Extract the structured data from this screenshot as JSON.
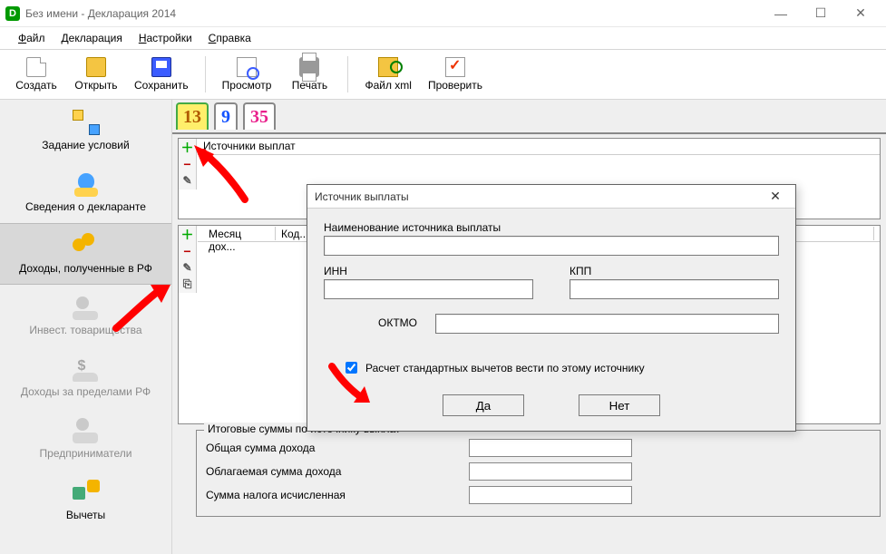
{
  "titlebar": {
    "title": "Без имени - Декларация 2014"
  },
  "menu": {
    "file": "Файл",
    "decl": "Декларация",
    "settings": "Настройки",
    "help": "Справка"
  },
  "toolbar": {
    "new": "Создать",
    "open": "Открыть",
    "save": "Сохранить",
    "preview": "Просмотр",
    "print": "Печать",
    "xml": "Файл xml",
    "check": "Проверить"
  },
  "sidebar": {
    "items": [
      {
        "label": "Задание условий"
      },
      {
        "label": "Сведения о декларанте"
      },
      {
        "label": "Доходы, полученные в РФ"
      },
      {
        "label": "Инвест. товарищества"
      },
      {
        "label": "Доходы за пределами РФ"
      },
      {
        "label": "Предприниматели"
      },
      {
        "label": "Вычеты"
      }
    ]
  },
  "rates": {
    "r13": "13",
    "r9": "9",
    "r35": "35"
  },
  "sources": {
    "header": "Источники выплат"
  },
  "months": {
    "col_month": "Месяц дох...",
    "col_code": "Код..."
  },
  "totals": {
    "legend": "Итоговые суммы по источнику выплат",
    "row1": "Общая сумма дохода",
    "row2": "Облагаемая сумма дохода",
    "row3": "Сумма налога исчисленная"
  },
  "dialog": {
    "title": "Источник выплаты",
    "name_label": "Наименование источника выплаты",
    "name_value": "",
    "inn_label": "ИНН",
    "inn_value": "",
    "kpp_label": "КПП",
    "kpp_value": "",
    "oktmo_label": "ОКТМО",
    "oktmo_value": "",
    "checkbox_label": "Расчет стандартных вычетов вести по этому источнику",
    "checkbox_checked": true,
    "yes": "Да",
    "no": "Нет"
  }
}
